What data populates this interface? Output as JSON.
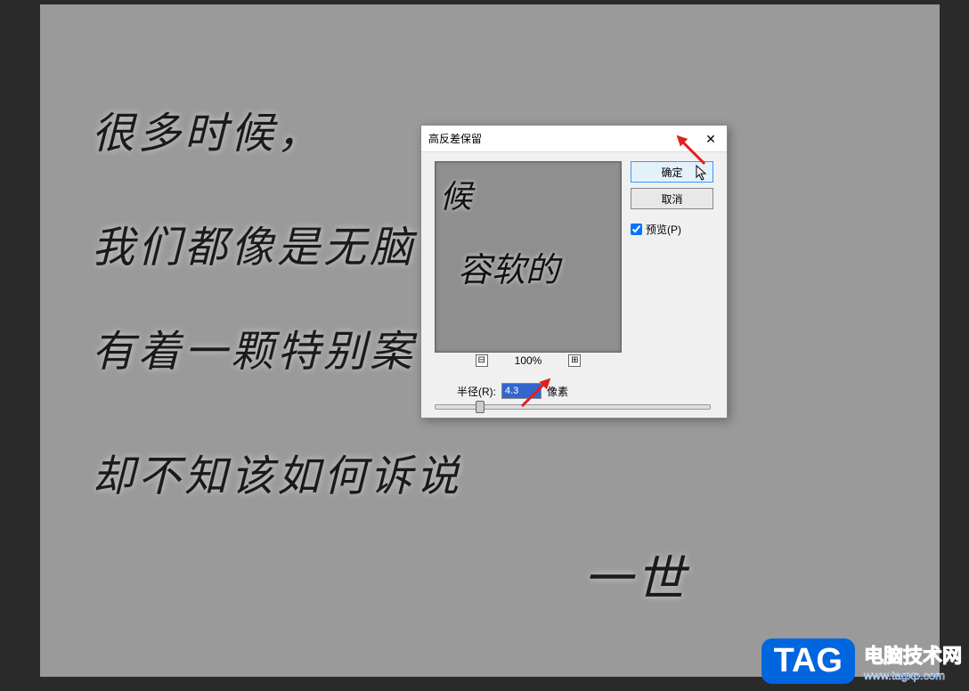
{
  "handwriting": {
    "line1": "很多时候，",
    "line2": "我们都像是无脑",
    "line3": "有着一颗特别案",
    "line4": "却不知该如何诉说",
    "signature": "一世"
  },
  "dialog": {
    "title": "高反差保留",
    "ok_label": "确定",
    "cancel_label": "取消",
    "preview_label": "预览(P)",
    "preview_checked": true,
    "zoom_level": "100%",
    "radius_label": "半径(R):",
    "radius_value": "4.3",
    "radius_unit": "像素"
  },
  "preview_text": {
    "line1": "候",
    "line2": "容软的"
  },
  "watermark": {
    "tag": "TAG",
    "name": "电脑技术网",
    "url": "www.tagxp.com"
  }
}
